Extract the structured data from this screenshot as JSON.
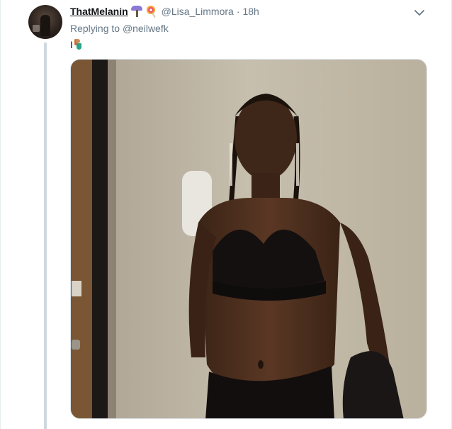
{
  "tweet": {
    "display_name": "ThatMelanin",
    "handle": "@Lisa_Limmora",
    "separator": "·",
    "time": "18h",
    "replying_prefix": "Replying to",
    "replying_to": "@neilwefk",
    "text": "I",
    "emojis": {
      "name_badge_1": "tree-emoji-icon",
      "name_badge_2": "lollipop-emoji-icon",
      "text_emoji": "mermaid-emoji-icon"
    }
  },
  "colors": {
    "primary_text": "#14171a",
    "secondary_text": "#657786",
    "thread_line": "#cfd9de",
    "border": "#e6ecf0"
  },
  "icons": {
    "menu": "chevron-down-icon",
    "avatar": "avatar-image"
  }
}
